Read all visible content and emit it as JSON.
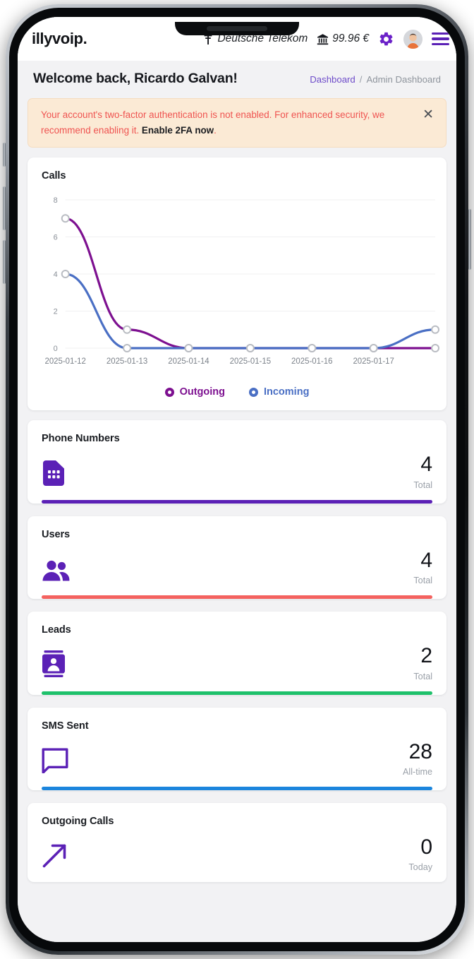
{
  "header": {
    "brand": "illyvoip.",
    "carrier": "Deutsche Telekom",
    "carrier_icon": "cell-tower-icon",
    "balance": "99.96 €",
    "balance_icon": "bank-icon",
    "settings_icon": "gear-icon",
    "avatar_icon": "user-avatar",
    "menu_icon": "hamburger-menu-icon"
  },
  "page": {
    "title": "Welcome back, Ricardo Galvan!",
    "breadcrumb": {
      "root": "Dashboard",
      "separator": "/",
      "current": "Admin Dashboard"
    }
  },
  "alert": {
    "message": "Your account's two-factor authentication is not enabled. For enhanced security, we recommend enabling it. ",
    "cta": "Enable 2FA now",
    "period": ".",
    "close_icon": "close-icon",
    "bg_color": "#fbead5",
    "text_color": "#ef5350"
  },
  "chart_card": {
    "title": "Calls",
    "legend": [
      {
        "label": "Outgoing",
        "color": "#7d1090"
      },
      {
        "label": "Incoming",
        "color": "#4a6fc4"
      }
    ]
  },
  "chart_data": {
    "type": "line",
    "title": "Calls",
    "xlabel": "",
    "ylabel": "",
    "x": [
      "2025-01-12",
      "2025-01-13",
      "2025-01-14",
      "2025-01-15",
      "2025-01-16",
      "2025-01-17",
      ""
    ],
    "categories": [
      "2025-01-12",
      "2025-01-13",
      "2025-01-14",
      "2025-01-15",
      "2025-01-16",
      "2025-01-17",
      ""
    ],
    "xtick_labels": [
      "2025-01-12",
      "2025-01-13",
      "2025-01-14",
      "2025-01-15",
      "2025-01-16",
      "2025-01-17"
    ],
    "ytick_labels": [
      "0",
      "2",
      "4",
      "6",
      "8"
    ],
    "yticks": [
      0,
      2,
      4,
      6,
      8
    ],
    "ylim": [
      0,
      8
    ],
    "grid": true,
    "legend_position": "bottom-center",
    "series": [
      {
        "name": "Outgoing",
        "color": "#7d1090",
        "values": [
          7,
          1,
          0,
          0,
          0,
          0,
          0
        ]
      },
      {
        "name": "Incoming",
        "color": "#4a6fc4",
        "values": [
          4,
          0,
          0,
          0,
          0,
          0,
          1
        ]
      }
    ]
  },
  "stats": [
    {
      "title": "Phone Numbers",
      "icon": "sim-card-icon",
      "value": "4",
      "label": "Total",
      "bar_color": "#5b21b6"
    },
    {
      "title": "Users",
      "icon": "users-group-icon",
      "value": "4",
      "label": "Total",
      "bar_color": "#f4625f"
    },
    {
      "title": "Leads",
      "icon": "contact-card-icon",
      "value": "2",
      "label": "Total",
      "bar_color": "#1fc16b"
    },
    {
      "title": "SMS Sent",
      "icon": "chat-bubble-icon",
      "value": "28",
      "label": "All-time",
      "bar_color": "#1b85dd"
    },
    {
      "title": "Outgoing Calls",
      "icon": "arrow-up-right-icon",
      "value": "0",
      "label": "Today",
      "bar_color": ""
    }
  ]
}
